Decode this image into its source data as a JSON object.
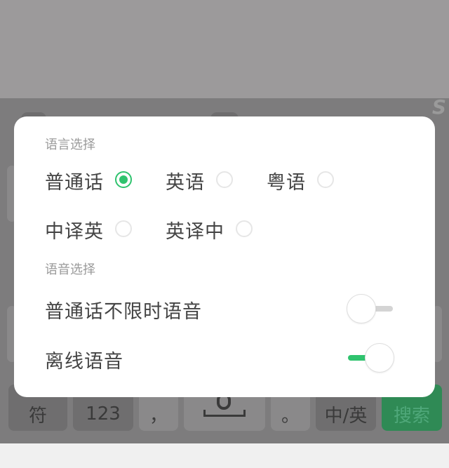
{
  "keyboard": {
    "keys": [
      {
        "id": "symbol",
        "label": "符"
      },
      {
        "id": "numbers",
        "label": "123"
      },
      {
        "id": "comma",
        "label": "，"
      },
      {
        "id": "period",
        "label": "。"
      },
      {
        "id": "lang-switch",
        "label": "中/英"
      },
      {
        "id": "search",
        "label": "搜索"
      }
    ]
  },
  "dialog": {
    "language_section_title": "语言选择",
    "languages": [
      {
        "label": "普通话",
        "selected": true
      },
      {
        "label": "英语",
        "selected": false
      },
      {
        "label": "粤语",
        "selected": false
      },
      {
        "label": "中译英",
        "selected": false
      },
      {
        "label": "英译中",
        "selected": false
      }
    ],
    "voice_section_title": "语音选择",
    "voice_options": [
      {
        "label": "普通话不限时语音",
        "enabled": false
      },
      {
        "label": "离线语音",
        "enabled": true
      }
    ]
  },
  "colors": {
    "accent": "#2fc36e",
    "dim_overlay": "#9c9a9b",
    "dialog_bg": "#ffffff"
  }
}
